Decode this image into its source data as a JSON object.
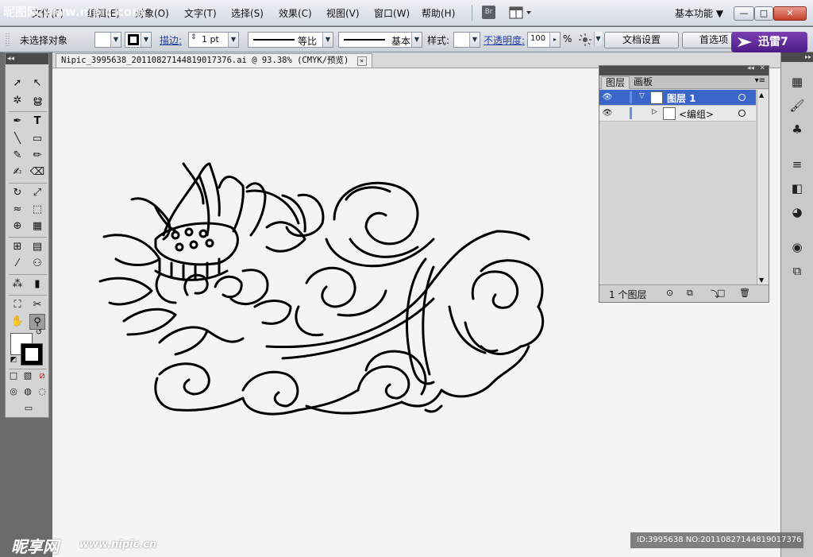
{
  "menubar": {
    "items": [
      "文件(F)",
      "编辑(E)",
      "对象(O)",
      "文字(T)",
      "选择(S)",
      "效果(C)",
      "视图(V)",
      "窗口(W)",
      "帮助(H)"
    ],
    "bridge_label": "Br",
    "workspace_label": "基本功能 ▼",
    "win_min": "—",
    "win_max": "□",
    "win_close": "✕"
  },
  "control_bar": {
    "selection_status": "未选择对象",
    "stroke_label": "描边:",
    "stroke_value": "1 pt",
    "stroke_profile_label": "等比",
    "brush_label": "基本",
    "style_label": "样式:",
    "opacity_label": "不透明度:",
    "opacity_value": "100",
    "opacity_unit": "%",
    "doc_settings_button": "文档设置",
    "prefs_button": "首选项",
    "xunlei_label": "迅雷7"
  },
  "document": {
    "tab_title": "Nipic_3995638_20110827144819017376.ai @ 93.38% (CMYK/预览)",
    "tab_close": "✕"
  },
  "layers_panel": {
    "tabs": [
      "图层",
      "画板"
    ],
    "rows": [
      {
        "name": "图层 1",
        "selected": true,
        "expander": "▽"
      },
      {
        "name": "<编组>",
        "selected": false,
        "expander": "▷"
      }
    ],
    "count_label": "1 个图层"
  },
  "watermarks": {
    "top_left": "昵图网 www.nipic.com",
    "bottom_left_logo": "昵享网",
    "bottom_left_url": "www.nipic.cn",
    "bottom_right": "ID:3995638 NO:20110827144819017376"
  },
  "colors": {
    "accent_blue": "#3b66c9",
    "xunlei_purple": "#5a2695",
    "canvas_bg": "#f4f4f4",
    "artwork_stroke": "#000000"
  }
}
